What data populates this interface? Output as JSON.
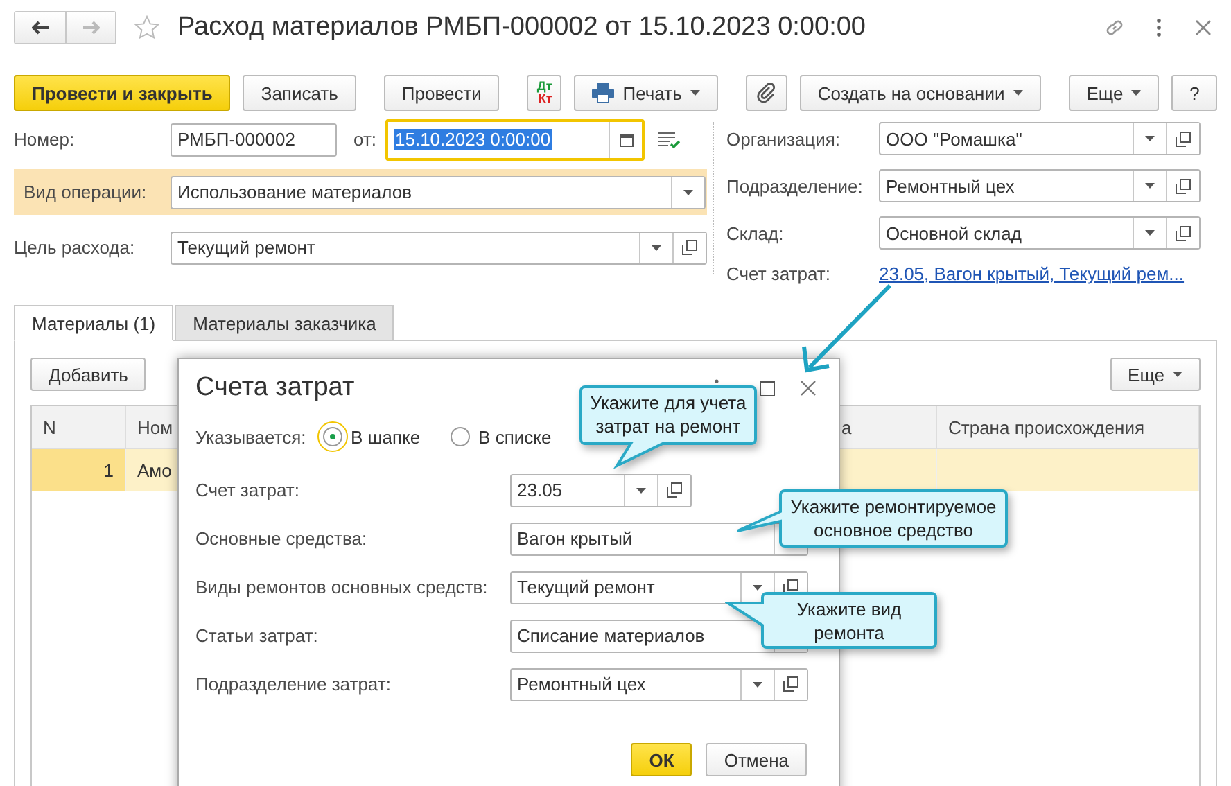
{
  "window": {
    "title": "Расход материалов РМБП-000002 от 15.10.2023 0:00:00"
  },
  "toolbar": {
    "groups": [
      [
        {
          "kind": "primary",
          "label": "Провести и закрыть"
        },
        {
          "kind": "plain",
          "label": "Записать"
        }
      ],
      [
        {
          "kind": "plain",
          "label": "Провести"
        }
      ],
      [
        {
          "kind": "dtkt",
          "dt": "Дт",
          "kt": "Кт"
        },
        {
          "kind": "print",
          "label": "Печать"
        }
      ],
      [
        {
          "kind": "attach"
        },
        {
          "kind": "menu",
          "label": "Создать на основании"
        }
      ],
      [
        {
          "kind": "menu",
          "label": "Еще"
        },
        {
          "kind": "plain",
          "label": "?"
        }
      ]
    ]
  },
  "header": {
    "number": {
      "label": "Номер:",
      "value": "РМБП-000002"
    },
    "date": {
      "label": "от:",
      "value": "15.10.2023  0:00:00"
    },
    "operation": {
      "label": "Вид операции:",
      "value": "Использование материалов",
      "highlighted": true
    },
    "purpose": {
      "label": "Цель расхода:",
      "value": "Текущий ремонт"
    },
    "organization": {
      "label": "Организация:",
      "value": "ООО \"Ромашка\""
    },
    "department": {
      "label": "Подразделение:",
      "value": "Ремонтный цех"
    },
    "warehouse": {
      "label": "Склад:",
      "value": "Основной склад"
    },
    "cost_account": {
      "label": "Счет затрат:",
      "link": "23.05, Вагон крытый, Текущий рем..."
    }
  },
  "tabs": [
    {
      "label": "Материалы (1)",
      "selected": true
    },
    {
      "label": "Материалы заказчика",
      "selected": false
    }
  ],
  "table": {
    "add_button": "Добавить",
    "more_button": "Еще",
    "columns": [
      "N",
      "Ном",
      "а",
      "Страна происхождения"
    ],
    "rows": [
      {
        "cells": [
          "1",
          "Амо"
        ],
        "selected": true
      }
    ]
  },
  "dialog": {
    "title": "Счета затрат",
    "specified": {
      "label": "Указывается:",
      "options": [
        {
          "label": "В шапке",
          "selected": true
        },
        {
          "label": "В списке",
          "selected": false
        }
      ]
    },
    "fields": [
      {
        "label": "Счет затрат:",
        "value": "23.05",
        "kind": "short",
        "open_button": true
      },
      {
        "label": "Основные средства:",
        "value": "Вагон крытый",
        "kind": "wide",
        "open_button": false
      },
      {
        "label": "Виды ремонтов основных средств:",
        "value": "Текущий ремонт",
        "kind": "wide",
        "open_button": true
      },
      {
        "label": "Статьи затрат:",
        "value": "Списание материалов",
        "kind": "wide",
        "open_button": false
      },
      {
        "label": "Подразделение затрат:",
        "value": "Ремонтный цех",
        "kind": "wide",
        "open_button": true
      }
    ],
    "ok": "ОК",
    "cancel": "Отмена"
  },
  "callouts": [
    {
      "lines": [
        "Укажите для учета",
        "затрат на ремонт"
      ]
    },
    {
      "lines": [
        "Укажите ремонтируемое",
        "основное средство"
      ]
    },
    {
      "lines": [
        "Укажите вид",
        "ремонта"
      ]
    }
  ]
}
